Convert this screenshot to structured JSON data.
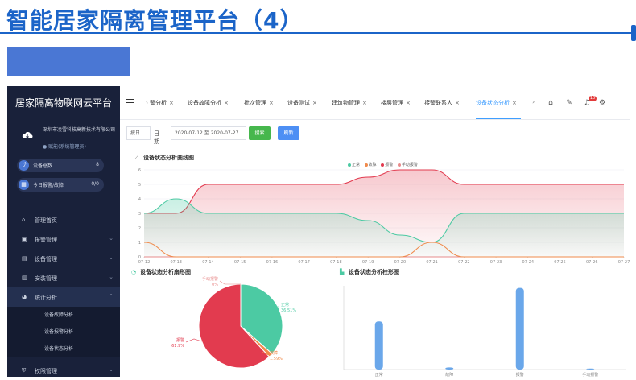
{
  "slide": {
    "title": "智能居家隔离管理平台（4）"
  },
  "sidebar": {
    "logo": "居家隔离物联网云平台",
    "company": "深圳市凌雪科技高新技术有限公司",
    "role": "● 赋能(系统管理员)",
    "stats": [
      {
        "icon": "trend-icon",
        "label": "设备总数",
        "value": "8"
      },
      {
        "icon": "calendar-icon",
        "label": "今日报警/故障",
        "value": "0/0"
      }
    ],
    "menu": [
      {
        "label": "管理首页",
        "icon": "home-icon",
        "arrow": ""
      },
      {
        "label": "报警管理",
        "icon": "alarm-icon",
        "arrow": "⌄"
      },
      {
        "label": "设备管理",
        "icon": "device-icon",
        "arrow": "⌄"
      },
      {
        "label": "安装管理",
        "icon": "install-icon",
        "arrow": "⌄"
      },
      {
        "label": "统计分析",
        "icon": "pie-icon",
        "arrow": "⌃"
      }
    ],
    "submenu": [
      "设备故障分析",
      "设备报警分析",
      "设备状态分析"
    ],
    "last_item": {
      "label": "权限管理",
      "icon": "shield-icon",
      "arrow": "⌄"
    }
  },
  "tabs": {
    "prev": "‹",
    "next": "›",
    "items": [
      {
        "label": "警分析",
        "active": false
      },
      {
        "label": "设备故障分析",
        "active": false
      },
      {
        "label": "批次管理",
        "active": false
      },
      {
        "label": "设备测试",
        "active": false
      },
      {
        "label": "建筑物管理",
        "active": false
      },
      {
        "label": "楼层管理",
        "active": false
      },
      {
        "label": "接警联系人",
        "active": false
      },
      {
        "label": "设备状态分析",
        "active": true
      }
    ],
    "close": "×",
    "notification_count": "10"
  },
  "filter": {
    "select_value": "按日",
    "date_label": "日期",
    "date_range": "2020-07-12 至 2020-07-27",
    "search_label": "搜索",
    "refresh_label": "刷新"
  },
  "colors": {
    "normal": "#4ccaa3",
    "fault": "#f08a4b",
    "alarm": "#e23b4f",
    "manual": "#e88b8b"
  },
  "line_chart": {
    "title": "设备状态分析曲线图",
    "legend": [
      "正常",
      "故障",
      "报警",
      "手动报警"
    ]
  },
  "pie_chart": {
    "title": "设备状态分析扇形图",
    "labels": [
      {
        "name": "手动报警",
        "pct": "0%"
      },
      {
        "name": "正常",
        "pct": "36.51%"
      },
      {
        "name": "故障",
        "pct": "1.59%"
      },
      {
        "name": "报警",
        "pct": "61.9%"
      }
    ]
  },
  "bar_chart": {
    "title": "设备状态分析柱形图"
  },
  "chart_data": [
    {
      "type": "line",
      "title": "设备状态分析曲线图",
      "x": [
        "07-12",
        "07-13",
        "07-14",
        "07-15",
        "07-16",
        "07-17",
        "07-18",
        "07-19",
        "07-20",
        "07-21",
        "07-22",
        "07-23",
        "07-24",
        "07-25",
        "07-26",
        "07-27"
      ],
      "series": [
        {
          "name": "正常",
          "values": [
            3,
            4,
            3,
            3,
            3,
            3,
            3,
            2.5,
            1.5,
            1,
            3,
            3,
            3,
            3,
            3,
            3
          ]
        },
        {
          "name": "故障",
          "values": [
            1,
            0,
            0,
            0,
            0,
            0,
            0,
            0,
            0,
            1,
            0,
            0,
            0,
            0,
            0,
            0
          ]
        },
        {
          "name": "报警",
          "values": [
            3,
            3,
            5,
            5,
            5,
            5,
            5,
            5.5,
            6,
            6,
            5,
            5,
            5,
            5,
            5,
            5
          ]
        },
        {
          "name": "手动报警",
          "values": [
            0,
            0,
            0,
            0,
            0,
            0,
            0,
            0,
            0,
            0,
            0,
            0,
            0,
            0,
            0,
            0
          ]
        }
      ],
      "ylim": [
        0,
        6
      ],
      "yticks": [
        0,
        1,
        2,
        3,
        4,
        5,
        6
      ],
      "grid": true,
      "legend": "top-center"
    },
    {
      "type": "pie",
      "title": "设备状态分析扇形图",
      "slices": [
        {
          "name": "正常",
          "value": 36.51
        },
        {
          "name": "故障",
          "value": 1.59
        },
        {
          "name": "报警",
          "value": 61.9
        },
        {
          "name": "手动报警",
          "value": 0
        }
      ]
    },
    {
      "type": "bar",
      "title": "设备状态分析柱形图",
      "categories": [
        "正常",
        "故障",
        "报警",
        "手动报警"
      ],
      "values": [
        46,
        2,
        78,
        1
      ],
      "ylim": [
        0,
        80
      ]
    }
  ]
}
